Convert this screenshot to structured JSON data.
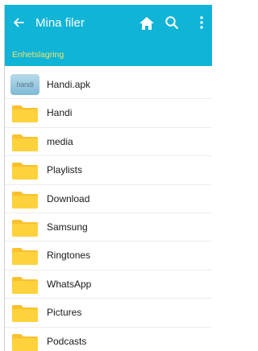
{
  "appbar": {
    "title": "Mina filer",
    "back_icon": "arrow-back-icon",
    "home_icon": "home-icon",
    "search_icon": "search-icon",
    "more_icon": "more-vert-icon",
    "color": "#0fb4d7"
  },
  "breadcrumb": {
    "label": "Enhetslagring",
    "color": "#f4e36a"
  },
  "files": [
    {
      "name": "Handi.apk",
      "type": "apk",
      "icon": "apk-thumbnail-icon",
      "icon_text": "handi"
    },
    {
      "name": "Handi",
      "type": "folder",
      "icon": "folder-icon"
    },
    {
      "name": "media",
      "type": "folder",
      "icon": "folder-icon"
    },
    {
      "name": "Playlists",
      "type": "folder",
      "icon": "folder-icon"
    },
    {
      "name": "Download",
      "type": "folder",
      "icon": "folder-icon"
    },
    {
      "name": "Samsung",
      "type": "folder",
      "icon": "folder-icon"
    },
    {
      "name": "Ringtones",
      "type": "folder",
      "icon": "folder-icon"
    },
    {
      "name": "WhatsApp",
      "type": "folder",
      "icon": "folder-icon"
    },
    {
      "name": "Pictures",
      "type": "folder",
      "icon": "folder-icon"
    },
    {
      "name": "Podcasts",
      "type": "folder",
      "icon": "folder-icon"
    }
  ],
  "folder_color": "#fbc02d"
}
